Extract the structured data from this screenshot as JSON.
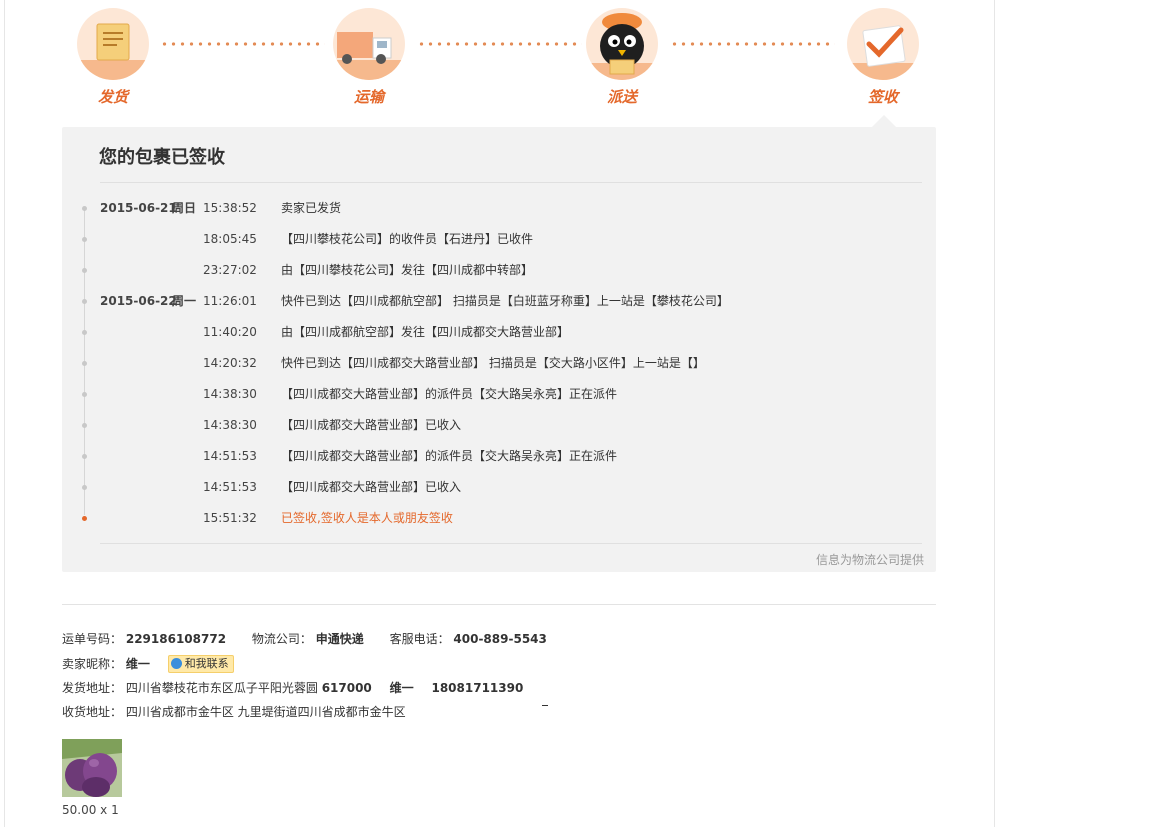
{
  "steps": [
    {
      "label": "发货",
      "icon": "document-icon"
    },
    {
      "label": "运输",
      "icon": "truck-icon"
    },
    {
      "label": "派送",
      "icon": "courier-icon"
    },
    {
      "label": "签收",
      "icon": "check-icon"
    }
  ],
  "panel": {
    "title": "您的包裹已签收",
    "provider": "信息为物流公司提供"
  },
  "timeline": [
    {
      "date": "2015-06-21",
      "weekday": "周日",
      "time": "15:38:52",
      "text": "卖家已发货"
    },
    {
      "date": "",
      "weekday": "",
      "time": "18:05:45",
      "text": "【四川攀枝花公司】的收件员【石进丹】已收件"
    },
    {
      "date": "",
      "weekday": "",
      "time": "23:27:02",
      "text": "由【四川攀枝花公司】发往【四川成都中转部】"
    },
    {
      "date": "2015-06-22",
      "weekday": "周一",
      "time": "11:26:01",
      "text": "快件已到达【四川成都航空部】 扫描员是【白班蓝牙称重】上一站是【攀枝花公司】"
    },
    {
      "date": "",
      "weekday": "",
      "time": "11:40:20",
      "text": "由【四川成都航空部】发往【四川成都交大路营业部】"
    },
    {
      "date": "",
      "weekday": "",
      "time": "14:20:32",
      "text": "快件已到达【四川成都交大路营业部】 扫描员是【交大路小区件】上一站是【】"
    },
    {
      "date": "",
      "weekday": "",
      "time": "14:38:30",
      "text": "【四川成都交大路营业部】的派件员【交大路吴永亮】正在派件"
    },
    {
      "date": "",
      "weekday": "",
      "time": "14:38:30",
      "text": "【四川成都交大路营业部】已收入"
    },
    {
      "date": "",
      "weekday": "",
      "time": "14:51:53",
      "text": "【四川成都交大路营业部】的派件员【交大路吴永亮】正在派件"
    },
    {
      "date": "",
      "weekday": "",
      "time": "14:51:53",
      "text": "【四川成都交大路营业部】已收入"
    },
    {
      "date": "",
      "weekday": "",
      "time": "15:51:32",
      "text": "已签收,签收人是本人或朋友签收"
    }
  ],
  "info": {
    "waybill_label": "运单号码：",
    "waybill": "229186108772",
    "company_label": "物流公司：",
    "company": "申通快递",
    "phone_label": "客服电话：",
    "phone": "400-889-5543",
    "seller_label": "卖家昵称：",
    "seller": "维一",
    "chat_label": "和我联系",
    "ship_label": "发货地址：",
    "ship_addr": "四川省攀枝花市东区瓜子平阳光蓉圆",
    "ship_zip": "617000",
    "ship_name": "维一",
    "ship_phone": "18081711390",
    "recv_label": "收货地址：",
    "recv_addr": "四川省成都市金牛区 九里堤街道四川省成都市金牛区"
  },
  "product": {
    "price": "50.00 x 1",
    "image": "plum-fruit-image"
  },
  "watermark": "",
  "colors": {
    "accent": "#e4682b",
    "panel_bg": "#f2f2f2",
    "step_circle": "#fde7d6"
  }
}
